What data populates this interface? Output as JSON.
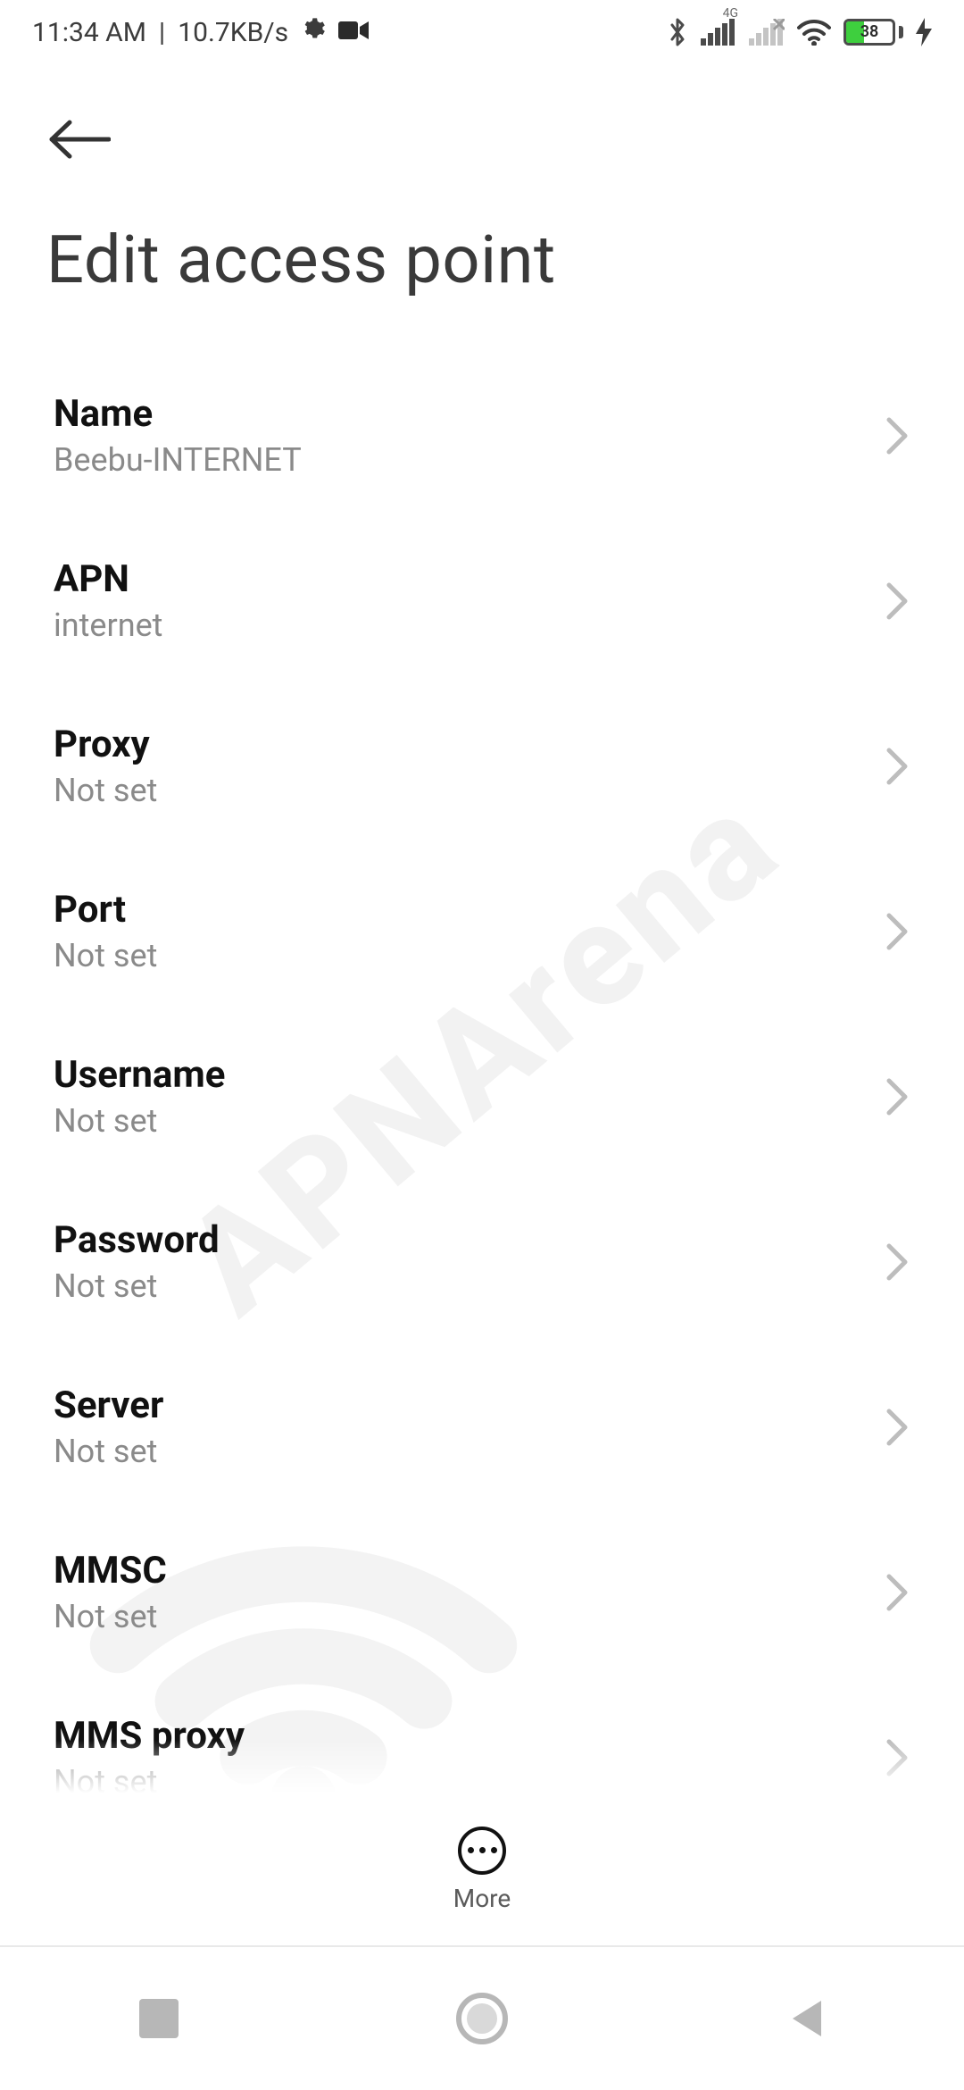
{
  "status": {
    "time": "11:34 AM",
    "separator": "|",
    "net_speed": "10.7KB/s",
    "signal_label": "4G",
    "battery_pct": "38",
    "battery_fill_pct": 38
  },
  "page": {
    "title": "Edit access point"
  },
  "settings": [
    {
      "label": "Name",
      "value": "Beebu-INTERNET"
    },
    {
      "label": "APN",
      "value": "internet"
    },
    {
      "label": "Proxy",
      "value": "Not set"
    },
    {
      "label": "Port",
      "value": "Not set"
    },
    {
      "label": "Username",
      "value": "Not set"
    },
    {
      "label": "Password",
      "value": "Not set"
    },
    {
      "label": "Server",
      "value": "Not set"
    },
    {
      "label": "MMSC",
      "value": "Not set"
    },
    {
      "label": "MMS proxy",
      "value": "Not set"
    }
  ],
  "action_bar": {
    "more_label": "More"
  },
  "watermark": {
    "text": "APNArena"
  }
}
